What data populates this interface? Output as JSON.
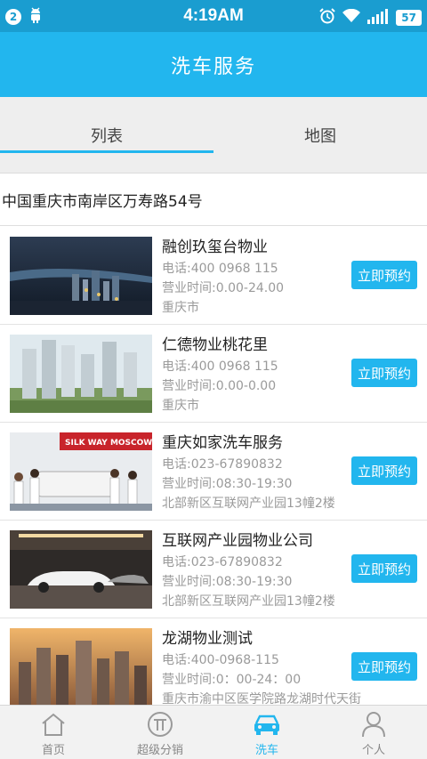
{
  "status_bar": {
    "notification_count": "2",
    "time": "4:19AM",
    "battery": "57"
  },
  "header": {
    "title": "洗车服务"
  },
  "tabs": [
    {
      "label": "列表",
      "active": true
    },
    {
      "label": "地图",
      "active": false
    }
  ],
  "location": {
    "address": "中国重庆市南岸区万寿路54号"
  },
  "book_label": "立即预约",
  "items": [
    {
      "name": "融创玖玺台物业",
      "phone": "电话:400 0968 115",
      "hours": "营业时间:0.00-24.00",
      "address": "重庆市"
    },
    {
      "name": "仁德物业桃花里",
      "phone": "电话:400 0968 115",
      "hours": "营业时间:0.00-0.00",
      "address": "重庆市"
    },
    {
      "name": "重庆如家洗车服务",
      "phone": "电话:023-67890832",
      "hours": "营业时间:08:30-19:30",
      "address": "北部新区互联网产业园13幢2楼"
    },
    {
      "name": "互联网产业园物业公司",
      "phone": "电话:023-67890832",
      "hours": "营业时间:08:30-19:30",
      "address": "北部新区互联网产业园13幢2楼"
    },
    {
      "name": "龙湖物业测试",
      "phone": "电话:400-0968-115",
      "hours": "营业时间:0：00-24：00",
      "address": "重庆市渝中区医学院路龙湖时代天街"
    }
  ],
  "thumb_banner_text": "SILK WAY MOSCOW–B",
  "bottom_nav": [
    {
      "label": "首页",
      "icon": "home-icon",
      "active": false
    },
    {
      "label": "超级分销",
      "icon": "distribution-icon",
      "active": false
    },
    {
      "label": "洗车",
      "icon": "car-icon",
      "active": true
    },
    {
      "label": "个人",
      "icon": "person-icon",
      "active": false
    }
  ],
  "colors": {
    "primary": "#22b6ee",
    "status_bar": "#1a9dd0",
    "text_muted": "#9a9a9a"
  }
}
